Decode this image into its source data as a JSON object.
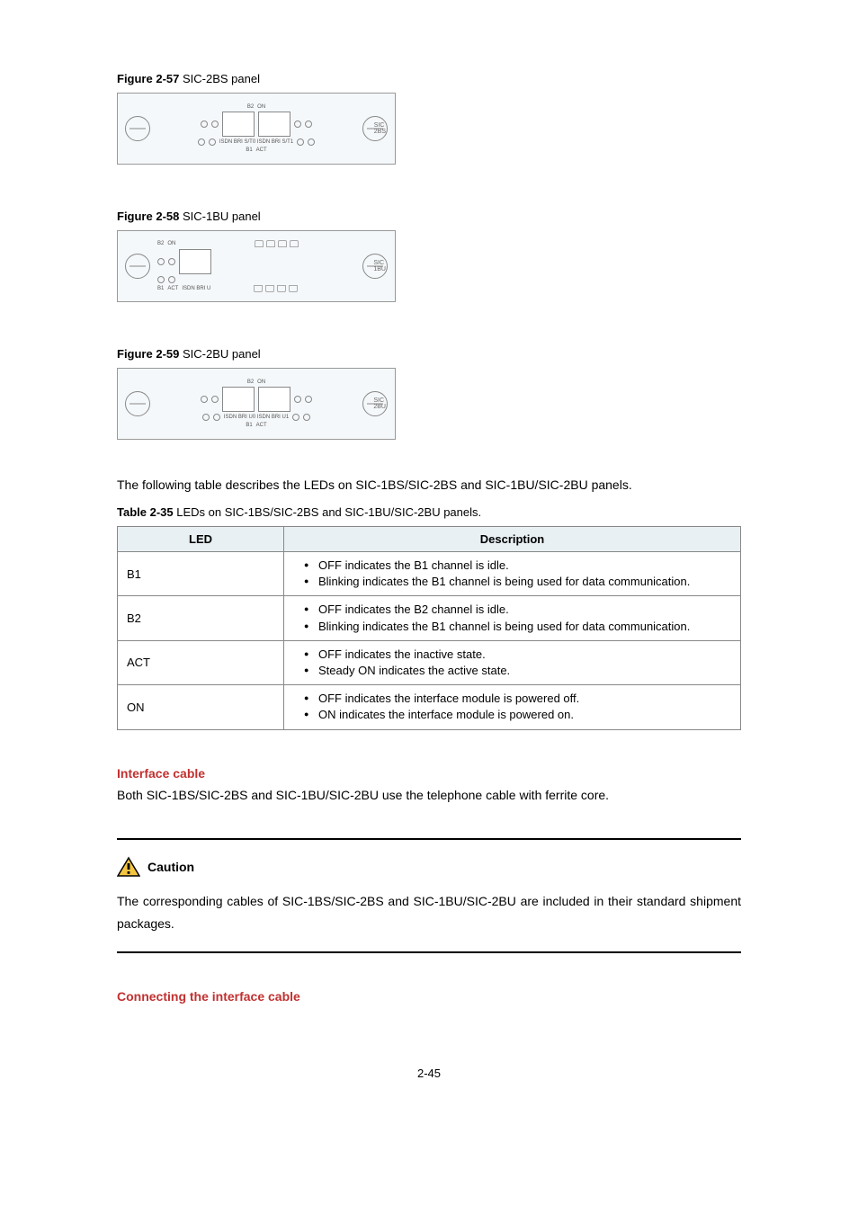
{
  "figures": {
    "f57": {
      "label": "Figure 2-57",
      "title": "SIC-2BS panel",
      "panel_label": "SIC\n2BS",
      "port_text": "ISDN BRI S/T0 ISDN BRI S/T1"
    },
    "f58": {
      "label": "Figure 2-58",
      "title": "SIC-1BU panel",
      "panel_label": "SIC\n1BU",
      "port_text": "ISDN BRI U"
    },
    "f59": {
      "label": "Figure 2-59",
      "title": "SIC-2BU panel",
      "panel_label": "SIC\n2BU",
      "port_text": "ISDN BRI U0  ISDN BRI U1"
    }
  },
  "intro_text": "The following table describes the LEDs on SIC-1BS/SIC-2BS and SIC-1BU/SIC-2BU panels.",
  "table": {
    "caption_label": "Table 2-35",
    "caption_title": "LEDs on SIC-1BS/SIC-2BS and SIC-1BU/SIC-2BU panels.",
    "headers": {
      "col1": "LED",
      "col2": "Description"
    },
    "rows": [
      {
        "led": "B1",
        "items": [
          "OFF indicates the B1 channel is idle.",
          "Blinking indicates the B1 channel is being used for data communication."
        ]
      },
      {
        "led": "B2",
        "items": [
          "OFF indicates the B2 channel is idle.",
          "Blinking indicates the B1 channel is being used for data communication."
        ]
      },
      {
        "led": "ACT",
        "items": [
          "OFF indicates the inactive state.",
          "Steady ON indicates the active state."
        ]
      },
      {
        "led": "ON",
        "items": [
          "OFF indicates the interface module is powered off.",
          "ON indicates the interface module is powered on."
        ]
      }
    ]
  },
  "interface_cable": {
    "heading": "Interface cable",
    "text": "Both SIC-1BS/SIC-2BS and SIC-1BU/SIC-2BU use the telephone cable with ferrite core."
  },
  "caution": {
    "label": "Caution",
    "text": "The corresponding cables of SIC-1BS/SIC-2BS and SIC-1BU/SIC-2BU are included in their standard shipment packages."
  },
  "connecting": {
    "heading": "Connecting the interface cable"
  },
  "page_number": "2-45",
  "led_labels": {
    "b2": "B2",
    "on": "ON",
    "b1": "B1",
    "act": "ACT"
  }
}
